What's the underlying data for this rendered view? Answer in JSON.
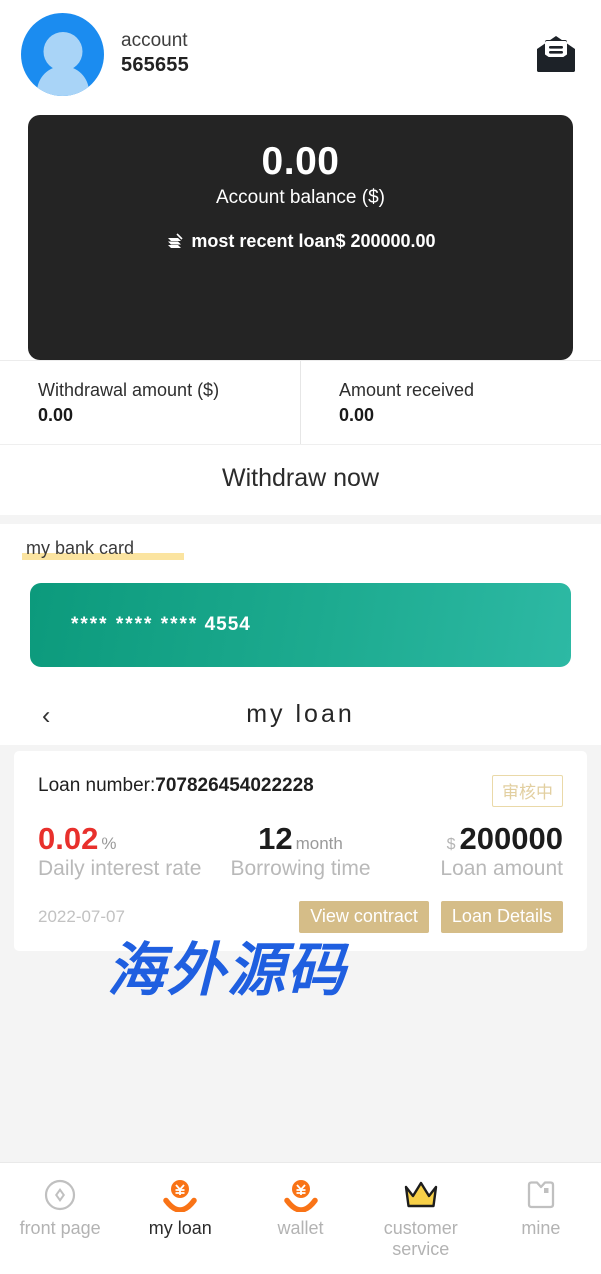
{
  "header": {
    "avatar_name": "user-avatar",
    "account_label": "account",
    "account_number": "565655",
    "mail_icon": "envelope-icon"
  },
  "balance_card": {
    "value": "0.00",
    "label": "Account balance ($)",
    "recent_loan_icon": "documents-stack-icon",
    "recent_loan_text": "most recent loan$ 200000.00"
  },
  "withdrawal": {
    "left_label": "Withdrawal amount ($)",
    "left_value": "0.00",
    "right_label": "Amount received",
    "right_value": "0.00",
    "button_label": "Withdraw now"
  },
  "bank": {
    "section_title": "my bank card",
    "card_mask": "**** **** ****",
    "card_last4": "4554"
  },
  "loan_nav": {
    "back_icon": "chevron-left-icon",
    "title": "my loan"
  },
  "loan_card": {
    "number_label": "Loan number:",
    "number_value": "707826454022228",
    "status": "审核中",
    "rate_value": "0.02",
    "rate_unit": "%",
    "rate_label": "Daily interest rate",
    "term_value": "12",
    "term_unit": "month",
    "term_label": "Borrowing time",
    "amount_prefix": "$",
    "amount_value": "200000",
    "amount_label": "Loan amount",
    "date": "2022-07-07",
    "view_contract_label": "View contract",
    "loan_details_label": "Loan Details"
  },
  "watermark": {
    "text": "海外源码"
  },
  "tabbar": {
    "items": [
      {
        "label": "front page",
        "icon": "compass-icon",
        "active": false
      },
      {
        "label": "my loan",
        "icon": "loan-hand-yen-icon",
        "active": true
      },
      {
        "label": "wallet",
        "icon": "wallet-hand-yen-icon",
        "active": false
      },
      {
        "label": "customer service",
        "icon": "crown-icon",
        "active": false
      },
      {
        "label": "mine",
        "icon": "profile-book-icon",
        "active": false
      }
    ]
  },
  "colors": {
    "accent_orange": "#f97316",
    "card_teal": "#0c9a7c",
    "badge_tan": "#d5bd88",
    "rate_red": "#e8302c",
    "avatar_blue": "#1b8cf0"
  }
}
